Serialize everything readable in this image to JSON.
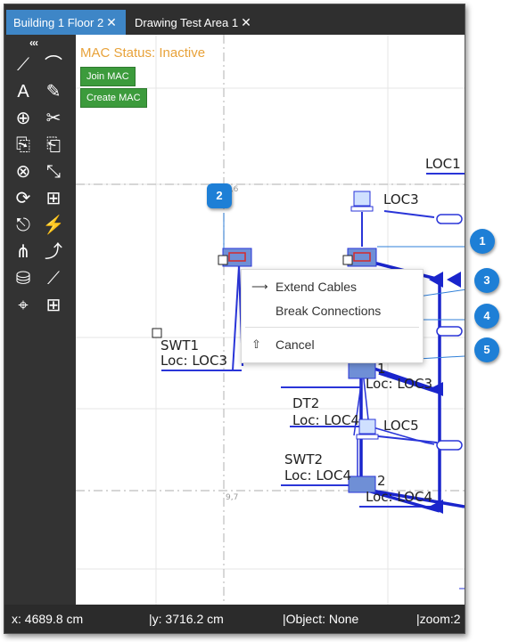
{
  "tabs": [
    {
      "label": "Building 1 Floor 2",
      "close": "✕",
      "active": true
    },
    {
      "label": "Drawing Test Area 1",
      "close": "✕",
      "active": false
    }
  ],
  "toolbar": {
    "collapse": "‹‹‹",
    "tools": [
      "draw-line-icon",
      "draw-arc-icon",
      "add-text-icon",
      "edit-text-icon",
      "add-object-icon",
      "cut-icon",
      "copy-icon",
      "paste-icon",
      "delete-icon",
      "scale-icon",
      "rotate-icon",
      "add-device-icon",
      "cable-icon",
      "plug-icon",
      "add-connection-icon",
      "route-icon",
      "add-layer-icon",
      "measure-icon",
      "add-location-icon",
      "add-group-icon"
    ]
  },
  "mac": {
    "status": "MAC Status: Inactive",
    "join_label": "Join MAC",
    "create_label": "Create MAC"
  },
  "context_menu": {
    "extend": "Extend Cables",
    "break": "Break Connections",
    "cancel": "Cancel"
  },
  "callouts": [
    "1",
    "2",
    "3",
    "4",
    "5"
  ],
  "drawing": {
    "grid_top": "9,6",
    "grid_bottom": "9,7",
    "loc1": "LOC1",
    "loc3_top": "LOC3",
    "swt1_name": "SWT1",
    "swt1_loc": "Loc: LOC3",
    "d1_suffix": "1",
    "d1_loc": "Loc: LOC3",
    "dt2_name": "DT2",
    "dt2_loc": "Loc: LOC4",
    "loc5": "LOC5",
    "swt2_name": "SWT2",
    "swt2_loc": "Loc: LOC4",
    "d2_suffix": "2",
    "d2_loc": "Loc: LOC4"
  },
  "status": {
    "x": "x: 4689.8 cm",
    "y": "|y: 3716.2 cm",
    "object": "|Object: None",
    "zoom": "|zoom:2"
  },
  "colors": {
    "accent": "#3e86c7",
    "cable": "#2a35d8",
    "callout": "#1e7fd6",
    "mac_status": "#e8a23a",
    "button": "#3c9b3c"
  }
}
